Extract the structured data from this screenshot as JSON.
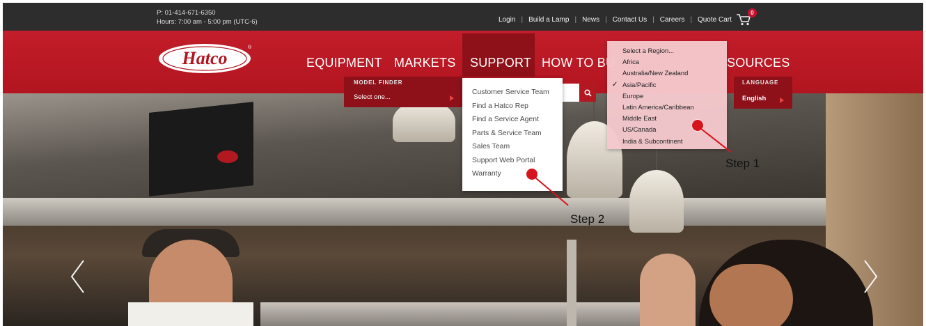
{
  "topbar": {
    "phone": "P: 01-414-671-6350",
    "hours": "Hours: 7:00 am - 5:00 pm (UTC-6)",
    "links": [
      "Login",
      "Build a Lamp",
      "News",
      "Contact Us",
      "Careers"
    ],
    "quote_cart_label": "Quote Cart",
    "cart_count": "0"
  },
  "brand": {
    "logo_text": "Hatco",
    "registered": "®",
    "accent": "#b2151f"
  },
  "nav": {
    "items": [
      "EQUIPMENT",
      "MARKETS",
      "SUPPORT",
      "HOW TO BU",
      "SOURCES"
    ],
    "active": "SUPPORT"
  },
  "model_finder": {
    "label": "MODEL FINDER",
    "value": "Select one..."
  },
  "language": {
    "label": "LANGUAGE",
    "value": "English"
  },
  "support_menu": {
    "items": [
      "Customer Service Team",
      "Find a Hatco Rep",
      "Find a Service Agent",
      "Parts & Service Team",
      "Sales Team",
      "Support Web Portal",
      "Warranty"
    ]
  },
  "region_menu": {
    "items": [
      "Select a Region...",
      "Africa",
      "Australia/New Zealand",
      "Asia/Pacific",
      "Europe",
      "Latin America/Caribbean",
      "Middle East",
      "US/Canada",
      "India & Subcontinent"
    ],
    "selected": "Asia/Pacific"
  },
  "annotations": {
    "step1": "Step 1",
    "step2": "Step 2",
    "color": "#d5141d"
  }
}
